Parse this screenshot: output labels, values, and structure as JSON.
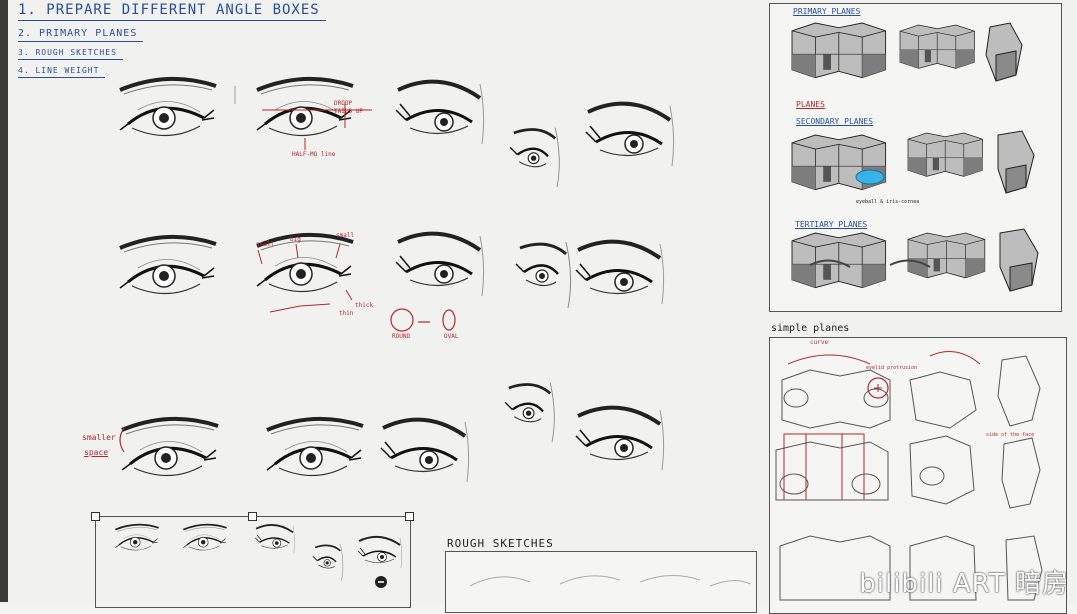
{
  "notes": [
    {
      "text": "1. PREPARE DIFFERENT ANGLE BOXES"
    },
    {
      "text": "2. PRIMARY PLANES"
    },
    {
      "text": "3. ROUGH SKETCHES"
    },
    {
      "text": "4. LINE WEIGHT"
    }
  ],
  "annotations": {
    "droop": "DROOP",
    "tails_up": "TAILS UP",
    "half_mo_line": "HALF-MO line",
    "small1": "small",
    "big": "big",
    "small2": "small",
    "thick": "thick",
    "thin": "thin",
    "round": "ROUND",
    "oval": "OVAL",
    "smaller": "smaller",
    "space": "space"
  },
  "reference_top": {
    "primary_planes": "PRIMARY PLANES",
    "planes": "PLANES",
    "secondary_planes": "SECONDARY PLANES",
    "tertiary_planes": "TERTIARY PLANES",
    "caption": "eyeball & iris-cornea",
    "highlight_color": "#37b3e8"
  },
  "reference_bottom": {
    "simple_planes": "simple planes",
    "curve": "curve",
    "curve_note": "eyelid protrusion",
    "side_note": "side of the face"
  },
  "rough_sketches": {
    "title": "ROUGH SKETCHES"
  },
  "watermark": {
    "text": "bilibili ART 暗房"
  }
}
